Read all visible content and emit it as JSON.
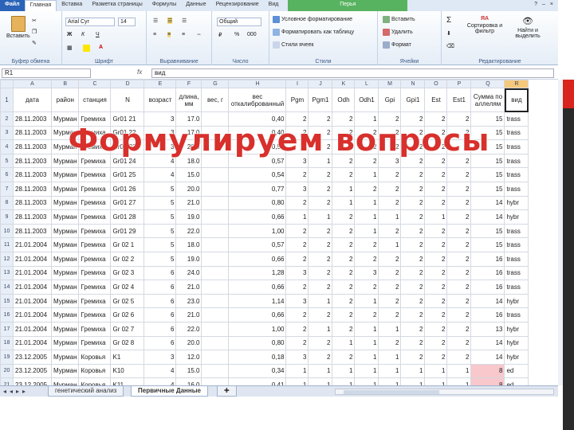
{
  "ribbon_tabs": [
    "Файл",
    "Главная",
    "Вставка",
    "Разметка страницы",
    "Формулы",
    "Данные",
    "Рецензирование",
    "Вид",
    "Перья"
  ],
  "active_tab": "Главная",
  "ribbon": {
    "clipboard": {
      "paste": "Вставить",
      "label": "Буфер обмена"
    },
    "font": {
      "name": "Arial Cyr",
      "size": "14",
      "bold": "Ж",
      "italic": "К",
      "underline": "Ч",
      "label": "Шрифт"
    },
    "alignment": {
      "label": "Выравнивание"
    },
    "number": {
      "format": "Общий",
      "percent": "%",
      "thousands": "000",
      "label": "Число"
    },
    "styles": {
      "conditional": "Условное форматирование",
      "as_table": "Форматировать как таблицу",
      "cell_styles": "Стили ячеек",
      "label": "Стили"
    },
    "cells": {
      "insert": "Вставить",
      "delete": "Удалить",
      "format": "Формат",
      "label": "Ячейки"
    },
    "editing": {
      "sigma": "Σ",
      "sort": "Сортировка и фильтр",
      "find": "Найти и выделить",
      "label": "Редактирование"
    }
  },
  "formula_bar": {
    "cell_ref": "R1",
    "fx": "fx",
    "value": "вид"
  },
  "columns": [
    "A",
    "B",
    "C",
    "D",
    "E",
    "F",
    "G",
    "H",
    "I",
    "J",
    "K",
    "L",
    "M",
    "N",
    "O",
    "P",
    "Q",
    "R"
  ],
  "header_row": [
    "дата",
    "район",
    "станция",
    "N",
    "возраст",
    "длина, мм",
    "вес, г",
    "вес откалиброванный",
    "Pgm",
    "Pgm1",
    "Odh",
    "Odh1",
    "Gpi",
    "Gpi1",
    "Est",
    "Est1",
    "Сумма по аллелям",
    "вид"
  ],
  "rows": [
    {
      "n": "2",
      "c": [
        "28.11.2003",
        "Мурман",
        "Гремиха",
        "Gr01 21",
        "3",
        "17.0",
        "",
        "0,40",
        "2",
        "2",
        "2",
        "1",
        "2",
        "2",
        "2",
        "2",
        "15",
        "trass"
      ]
    },
    {
      "n": "3",
      "c": [
        "28.11.2003",
        "Мурман",
        "Гремиха",
        "Gr01 22",
        "3",
        "17.0",
        "",
        "0,40",
        "2",
        "2",
        "2",
        "2",
        "2",
        "2",
        "2",
        "2",
        "15",
        "trass"
      ]
    },
    {
      "n": "4",
      "c": [
        "28.11.2003",
        "Мурман",
        "Гремиха",
        "Gr01 23",
        "3",
        "20.0",
        "",
        "0,57",
        "2",
        "2",
        "2",
        "2",
        "2",
        "2",
        "2",
        "2",
        "15",
        "trass"
      ]
    },
    {
      "n": "5",
      "c": [
        "28.11.2003",
        "Мурман",
        "Гремиха",
        "Gr01 24",
        "4",
        "18.0",
        "",
        "0,57",
        "3",
        "1",
        "2",
        "2",
        "3",
        "2",
        "2",
        "2",
        "15",
        "trass"
      ]
    },
    {
      "n": "6",
      "c": [
        "28.11.2003",
        "Мурман",
        "Гремиха",
        "Gr01 25",
        "4",
        "15.0",
        "",
        "0,54",
        "2",
        "2",
        "2",
        "1",
        "2",
        "2",
        "2",
        "2",
        "15",
        "trass"
      ]
    },
    {
      "n": "7",
      "c": [
        "28.11.2003",
        "Мурман",
        "Гремиха",
        "Gr01 26",
        "5",
        "20.0",
        "",
        "0,77",
        "3",
        "2",
        "1",
        "2",
        "2",
        "2",
        "2",
        "2",
        "15",
        "trass"
      ]
    },
    {
      "n": "8",
      "c": [
        "28.11.2003",
        "Мурман",
        "Гремиха",
        "Gr01 27",
        "5",
        "21.0",
        "",
        "0,80",
        "2",
        "2",
        "1",
        "1",
        "2",
        "2",
        "2",
        "2",
        "14",
        "hybr"
      ]
    },
    {
      "n": "9",
      "c": [
        "28.11.2003",
        "Мурман",
        "Гремиха",
        "Gr01 28",
        "5",
        "19.0",
        "",
        "0,66",
        "1",
        "1",
        "2",
        "1",
        "1",
        "2",
        "1",
        "2",
        "14",
        "hybr"
      ]
    },
    {
      "n": "10",
      "c": [
        "28.11.2003",
        "Мурман",
        "Гремиха",
        "Gr01 29",
        "5",
        "22.0",
        "",
        "1,00",
        "2",
        "2",
        "2",
        "1",
        "2",
        "2",
        "2",
        "2",
        "15",
        "trass"
      ]
    },
    {
      "n": "11",
      "c": [
        "21.01.2004",
        "Мурман",
        "Гремиха",
        "Gr 02 1",
        "5",
        "18.0",
        "",
        "0,57",
        "2",
        "2",
        "2",
        "2",
        "1",
        "2",
        "2",
        "2",
        "15",
        "trass"
      ]
    },
    {
      "n": "12",
      "c": [
        "21.01.2004",
        "Мурман",
        "Гремиха",
        "Gr 02 2",
        "5",
        "19.0",
        "",
        "0,66",
        "2",
        "2",
        "2",
        "2",
        "2",
        "2",
        "2",
        "2",
        "16",
        "trass"
      ]
    },
    {
      "n": "13",
      "c": [
        "21.01.2004",
        "Мурман",
        "Гремиха",
        "Gr 02 3",
        "6",
        "24.0",
        "",
        "1,28",
        "3",
        "2",
        "2",
        "3",
        "2",
        "2",
        "2",
        "2",
        "16",
        "trass"
      ]
    },
    {
      "n": "14",
      "c": [
        "21.01.2004",
        "Мурман",
        "Гремиха",
        "Gr 02 4",
        "6",
        "21.0",
        "",
        "0,66",
        "2",
        "2",
        "2",
        "2",
        "2",
        "2",
        "2",
        "2",
        "16",
        "trass"
      ]
    },
    {
      "n": "15",
      "c": [
        "21.01.2004",
        "Мурман",
        "Гремиха",
        "Gr 02 5",
        "6",
        "23.0",
        "",
        "1,14",
        "3",
        "1",
        "2",
        "1",
        "2",
        "2",
        "2",
        "2",
        "14",
        "hybr"
      ]
    },
    {
      "n": "16",
      "c": [
        "21.01.2004",
        "Мурман",
        "Гремиха",
        "Gr 02 6",
        "6",
        "21.0",
        "",
        "0,66",
        "2",
        "2",
        "2",
        "2",
        "2",
        "2",
        "2",
        "2",
        "16",
        "trass"
      ]
    },
    {
      "n": "17",
      "c": [
        "21.01.2004",
        "Мурман",
        "Гремиха",
        "Gr 02 7",
        "6",
        "22.0",
        "",
        "1,00",
        "2",
        "1",
        "2",
        "1",
        "1",
        "2",
        "2",
        "2",
        "13",
        "hybr"
      ]
    },
    {
      "n": "18",
      "c": [
        "21.01.2004",
        "Мурман",
        "Гремиха",
        "Gr 02 8",
        "6",
        "20.0",
        "",
        "0,80",
        "2",
        "2",
        "1",
        "1",
        "2",
        "2",
        "2",
        "2",
        "14",
        "hybr"
      ]
    },
    {
      "n": "19",
      "c": [
        "23.12.2005",
        "Мурман",
        "Коровья",
        "K1",
        "3",
        "12.0",
        "",
        "0,18",
        "3",
        "2",
        "2",
        "1",
        "1",
        "2",
        "2",
        "2",
        "14",
        "hybr"
      ]
    },
    {
      "n": "20",
      "c": [
        "23.12.2005",
        "Мурман",
        "Коровья",
        "K10",
        "4",
        "15.0",
        "",
        "0,34",
        "1",
        "1",
        "1",
        "1",
        "1",
        "1",
        "1",
        "1",
        "8",
        "ed"
      ]
    },
    {
      "n": "21",
      "c": [
        "23.12.2005",
        "Мурман",
        "Коровья",
        "K11",
        "4",
        "16.0",
        "",
        "0,41",
        "1",
        "1",
        "1",
        "1",
        "1",
        "1",
        "1",
        "1",
        "8",
        "ed"
      ]
    }
  ],
  "sheet_tabs": [
    "генетический анализ",
    "Первичные Данные"
  ],
  "active_sheet": "Первичные Данные",
  "overlay_title": "Формулируем вопросы",
  "colors": {
    "overlay": "#d8302c",
    "file_tab": "#2a63b8",
    "pink_cell": "#f8c8cc",
    "side_bar": "#d9231d"
  }
}
